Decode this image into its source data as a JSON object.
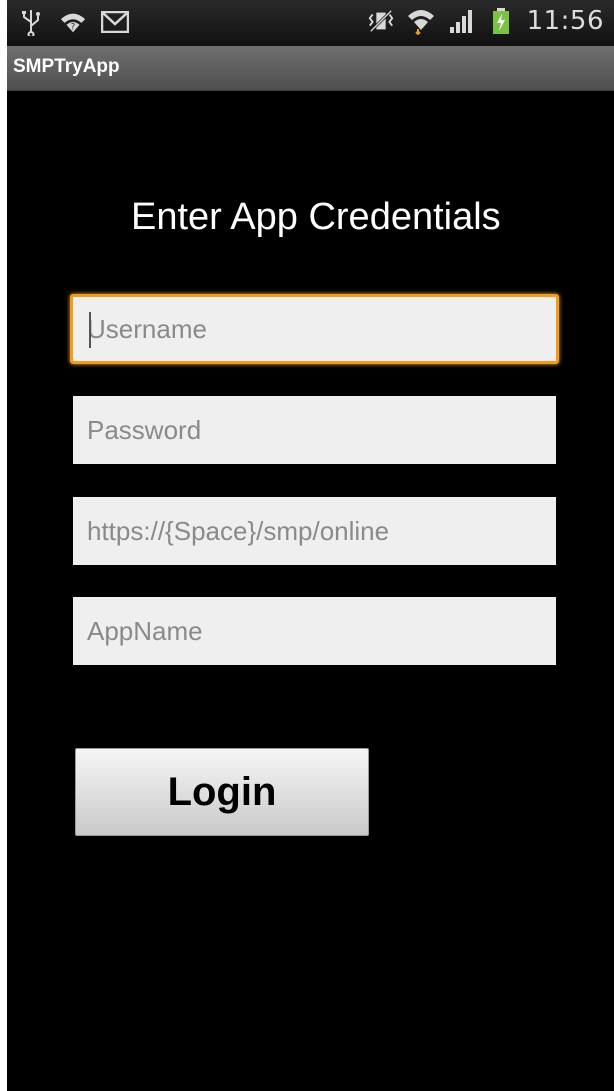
{
  "status_bar": {
    "time": "11:56",
    "icons": [
      "usb-icon",
      "wifi-notification-icon",
      "gmail-icon",
      "vibrate-mute-icon",
      "wifi-icon",
      "signal-icon",
      "battery-charging-icon"
    ]
  },
  "app": {
    "title": "SMPTryApp"
  },
  "form": {
    "heading": "Enter App Credentials",
    "username_placeholder": "Username",
    "password_placeholder": "Password",
    "url_placeholder": "https://{Space}/smp/online",
    "appname_placeholder": "AppName",
    "login_label": "Login"
  },
  "colors": {
    "focus_accent": "#f39c1b",
    "background": "#000000"
  }
}
